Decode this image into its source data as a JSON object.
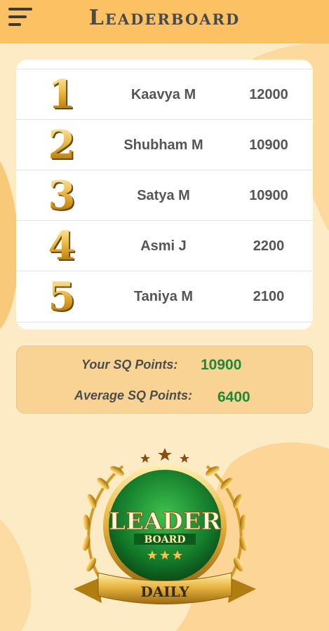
{
  "header": {
    "title": "Leaderboard",
    "menu_icon": "hamburger-menu-icon"
  },
  "leaderboard": {
    "rows": [
      {
        "rank": "1",
        "name": "Kaavya M",
        "score": "12000"
      },
      {
        "rank": "2",
        "name": "Shubham M",
        "score": "10900"
      },
      {
        "rank": "3",
        "name": "Satya M",
        "score": "10900"
      },
      {
        "rank": "4",
        "name": "Asmi J",
        "score": "2200"
      },
      {
        "rank": "5",
        "name": "Taniya M",
        "score": "2100"
      }
    ]
  },
  "points": {
    "your_label": "Your SQ Points:",
    "your_value": "10900",
    "avg_label": "Average SQ Points:",
    "avg_value": "6400"
  },
  "badge": {
    "line1": "LEADER",
    "line2": "BOARD",
    "ribbon": "DAILY"
  },
  "colors": {
    "header": "#fbc163",
    "background": "#fdebc6",
    "accent_green": "#1c8a36",
    "gold": "#d8a429"
  }
}
